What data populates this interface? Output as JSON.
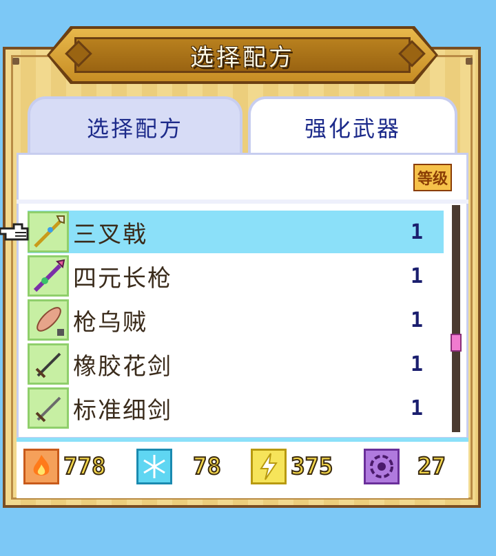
{
  "title": "选择配方",
  "tabs": [
    {
      "label": "选择配方",
      "active": false
    },
    {
      "label": "强化武器",
      "active": true
    }
  ],
  "level_header": "等级",
  "items": [
    {
      "name": "三叉戟",
      "level": "1",
      "icon": "trident-icon",
      "selected": true
    },
    {
      "name": "四元长枪",
      "level": "1",
      "icon": "spear-icon",
      "selected": false
    },
    {
      "name": "枪乌贼",
      "level": "1",
      "icon": "squid-icon",
      "selected": false
    },
    {
      "name": "橡胶花剑",
      "level": "1",
      "icon": "rubber-sword-icon",
      "selected": false
    },
    {
      "name": "标准细剑",
      "level": "1",
      "icon": "rapier-icon",
      "selected": false
    }
  ],
  "resources": [
    {
      "name": "fire",
      "value": "778",
      "icon": "fire-icon",
      "color": "#f08a2a"
    },
    {
      "name": "ice",
      "value": "78",
      "icon": "ice-icon",
      "color": "#39c7ea"
    },
    {
      "name": "thunder",
      "value": "375",
      "icon": "lightning-icon",
      "color": "#f3dd2e"
    },
    {
      "name": "dark",
      "value": "27",
      "icon": "vortex-icon",
      "color": "#a56cd4"
    }
  ]
}
